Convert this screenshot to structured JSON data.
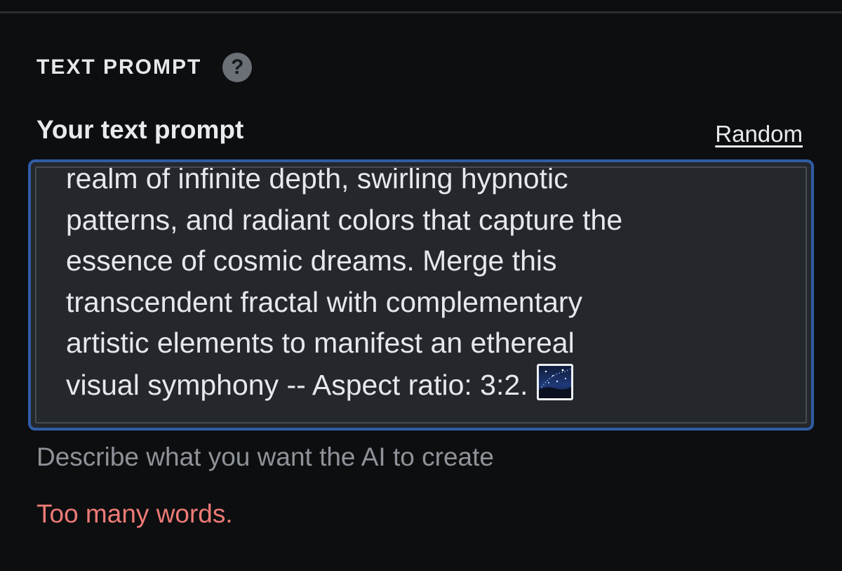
{
  "section": {
    "title": "TEXT PROMPT",
    "help_icon": "question-mark-icon"
  },
  "field": {
    "label": "Your text prompt",
    "random_label": "Random",
    "value": "realm of infinite depth, swirling hypnotic\npatterns, and radiant colors that capture the\nessence of cosmic dreams. Merge this\ntranscendent fractal with complementary\nartistic elements to manifest an ethereal\nvisual symphony -- Aspect ratio: 3:2.",
    "emoji_icon": "night-sky-icon",
    "helper": "Describe what you want the AI to create",
    "error": "Too many words."
  },
  "colors": {
    "background": "#0d0e10",
    "focus_border": "#2f5da6",
    "error": "#ee7b76",
    "helper": "#8e9399"
  }
}
